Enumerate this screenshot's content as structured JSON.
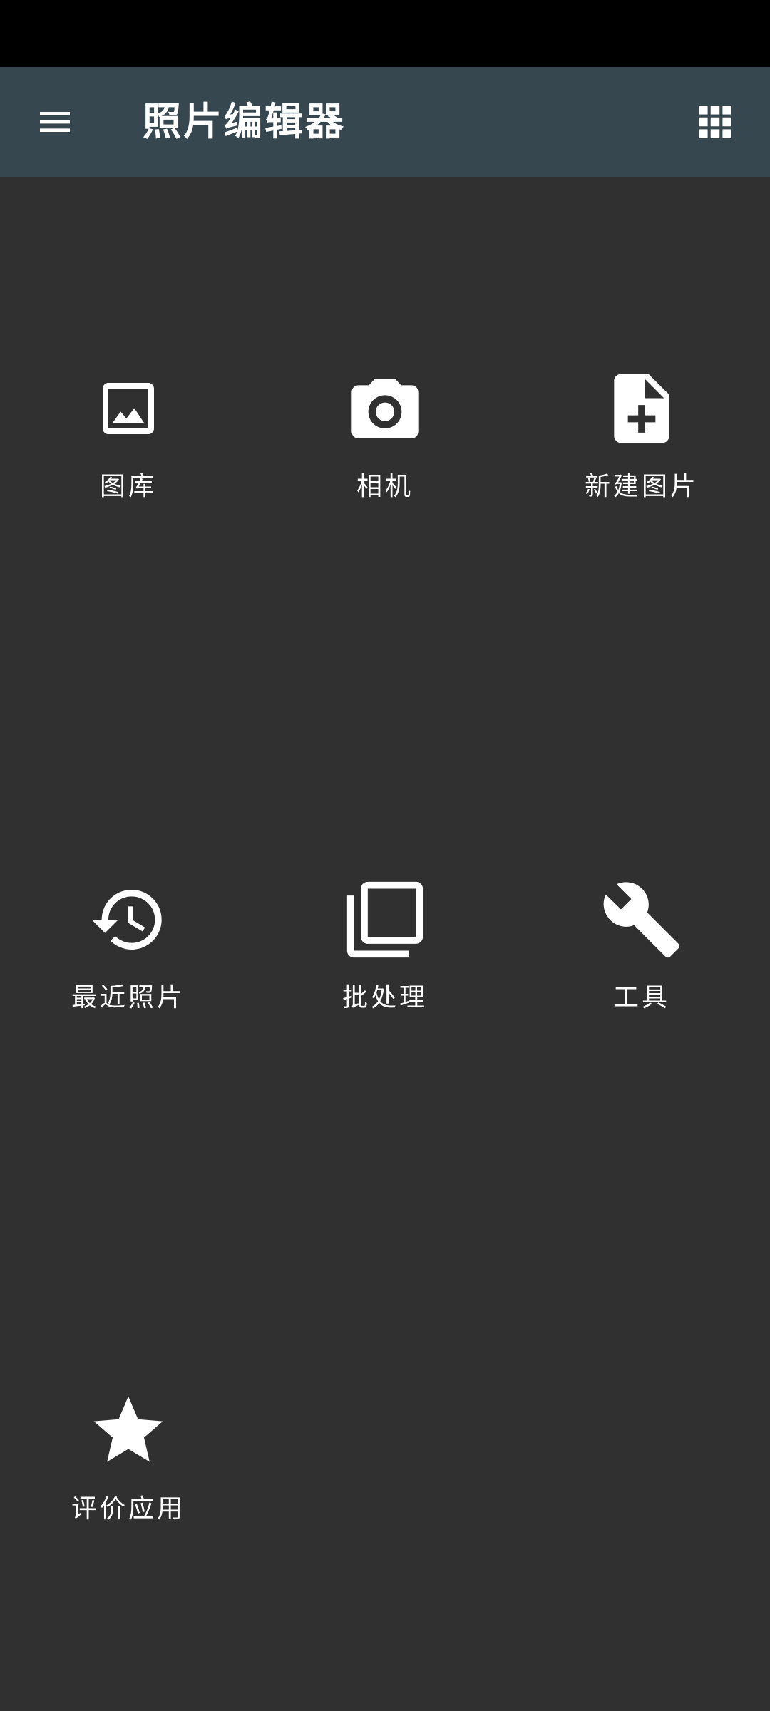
{
  "app": {
    "title": "照片编辑器"
  },
  "toolbar": {
    "menu_icon": "menu-icon",
    "apps_icon": "apps-grid-icon"
  },
  "tiles": [
    {
      "label": "图库",
      "icon": "image-icon"
    },
    {
      "label": "相机",
      "icon": "camera-icon"
    },
    {
      "label": "新建图片",
      "icon": "note-add-icon"
    },
    {
      "label": "最近照片",
      "icon": "history-icon"
    },
    {
      "label": "批处理",
      "icon": "filter-none-icon"
    },
    {
      "label": "工具",
      "icon": "wrench-icon"
    },
    {
      "label": "评价应用",
      "icon": "star-icon"
    }
  ],
  "colors": {
    "status_bar": "#000000",
    "app_bar": "#37474f",
    "background": "#303030",
    "foreground": "#ffffff"
  }
}
